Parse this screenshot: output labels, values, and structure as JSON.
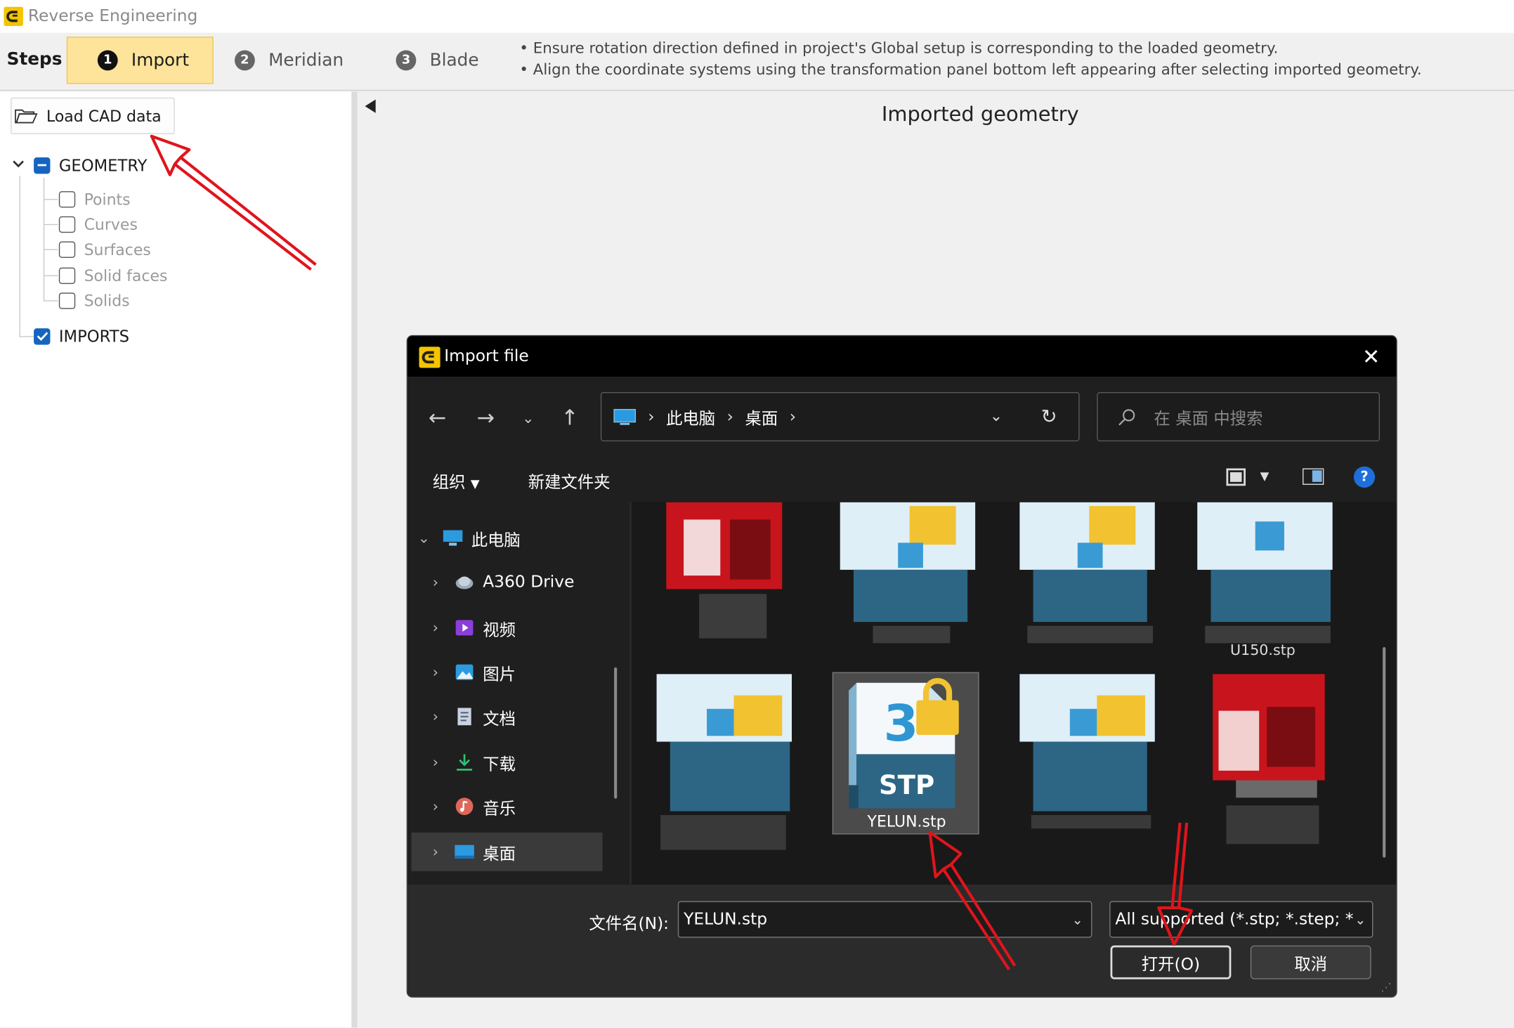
{
  "app": {
    "title": "Reverse Engineering",
    "accent": "#f5c400"
  },
  "steps": {
    "label": "Steps",
    "items": [
      {
        "num": "1",
        "label": "Import",
        "active": true
      },
      {
        "num": "2",
        "label": "Meridian",
        "active": false
      },
      {
        "num": "3",
        "label": "Blade",
        "active": false
      }
    ],
    "hints": [
      "• Ensure rotation direction defined in project's Global setup is corresponding to the loaded geometry.",
      "• Align the coordinate systems using the transformation panel bottom left appearing after selecting imported geometry."
    ]
  },
  "left_panel": {
    "load_button": "Load CAD data",
    "tree": {
      "geometry": {
        "label": "GEOMETRY",
        "children": [
          "Points",
          "Curves",
          "Surfaces",
          "Solid faces",
          "Solids"
        ]
      },
      "imports": {
        "label": "IMPORTS"
      }
    }
  },
  "canvas": {
    "title": "Imported geometry"
  },
  "dialog": {
    "title": "Import file",
    "close_icon": "close-icon",
    "address": [
      "此电脑",
      "桌面"
    ],
    "search_placeholder": "在 桌面 中搜索",
    "toolbar": {
      "organize": "组织",
      "new_folder": "新建文件夹"
    },
    "nav": [
      {
        "label": "此电脑",
        "icon": "computer-icon",
        "expanded": true
      },
      {
        "label": "A360 Drive",
        "icon": "cloud-drive-icon"
      },
      {
        "label": "视频",
        "icon": "video-icon"
      },
      {
        "label": "图片",
        "icon": "picture-icon"
      },
      {
        "label": "文档",
        "icon": "document-icon"
      },
      {
        "label": "下载",
        "icon": "download-icon"
      },
      {
        "label": "音乐",
        "icon": "music-icon"
      },
      {
        "label": "桌面",
        "icon": "desktop-icon",
        "selected": true
      }
    ],
    "files": {
      "partial_name": "U150.stp",
      "selected": {
        "name": "YELUN.stp",
        "badge": "STP",
        "digit": "3"
      }
    },
    "filename_label": "文件名(N):",
    "filename_value": "YELUN.stp",
    "filter_value": "All supported (*.stp; *.step; *",
    "open_button": "打开(O)",
    "cancel_button": "取消"
  }
}
